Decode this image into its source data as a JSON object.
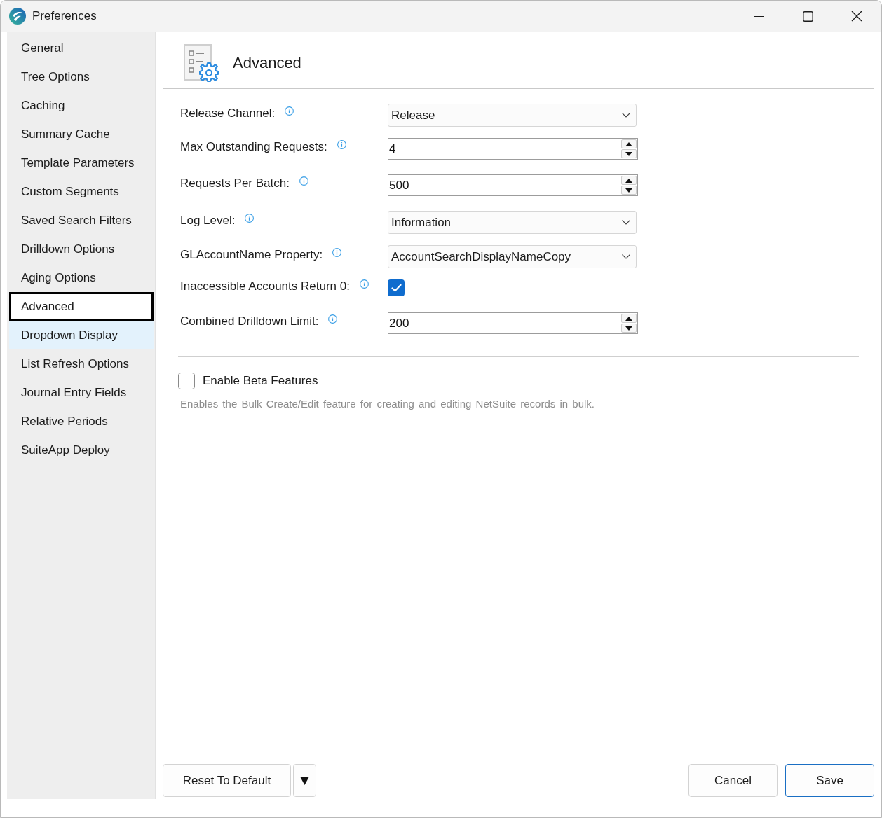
{
  "window": {
    "title": "Preferences"
  },
  "sidebar": {
    "items": [
      {
        "label": "General",
        "selected": false,
        "hovered": false
      },
      {
        "label": "Tree Options",
        "selected": false,
        "hovered": false
      },
      {
        "label": "Caching",
        "selected": false,
        "hovered": false
      },
      {
        "label": "Summary Cache",
        "selected": false,
        "hovered": false
      },
      {
        "label": "Template Parameters",
        "selected": false,
        "hovered": false
      },
      {
        "label": "Custom Segments",
        "selected": false,
        "hovered": false
      },
      {
        "label": "Saved Search Filters",
        "selected": false,
        "hovered": false
      },
      {
        "label": "Drilldown Options",
        "selected": false,
        "hovered": false
      },
      {
        "label": "Aging Options",
        "selected": false,
        "hovered": false
      },
      {
        "label": "Advanced",
        "selected": true,
        "hovered": false
      },
      {
        "label": "Dropdown Display",
        "selected": false,
        "hovered": true
      },
      {
        "label": "List Refresh Options",
        "selected": false,
        "hovered": false
      },
      {
        "label": "Journal Entry Fields",
        "selected": false,
        "hovered": false
      },
      {
        "label": "Relative Periods",
        "selected": false,
        "hovered": false
      },
      {
        "label": "SuiteApp Deploy",
        "selected": false,
        "hovered": false
      }
    ]
  },
  "page": {
    "title": "Advanced"
  },
  "settings": [
    {
      "kind": "dropdown",
      "label": "Release Channel:",
      "value": "Release"
    },
    {
      "kind": "spinner",
      "label": "Max Outstanding Requests:",
      "value": "4"
    },
    {
      "kind": "spinner",
      "label": "Requests Per Batch:",
      "value": "500"
    },
    {
      "kind": "dropdown",
      "label": "Log Level:",
      "value": "Information"
    },
    {
      "kind": "dropdown",
      "label": "GLAccountName Property:",
      "value": "AccountSearchDisplayNameCopy"
    },
    {
      "kind": "checkbox",
      "label": "Inaccessible Accounts Return 0:",
      "checked": true
    },
    {
      "kind": "spinner",
      "label": "Combined Drilldown Limit:",
      "value": "200"
    }
  ],
  "beta": {
    "checked": false,
    "label_parts": [
      {
        "text": "Enable ",
        "underlined": false
      },
      {
        "text": "B",
        "underlined": true
      },
      {
        "text": "eta Features",
        "underlined": false
      }
    ],
    "description": "Enables the Bulk Create/Edit feature for creating and editing NetSuite records in bulk."
  },
  "footer": {
    "reset": {
      "label": "Reset To Default"
    },
    "actions": [
      {
        "label": "Cancel",
        "default": false
      },
      {
        "label": "Save",
        "default": true
      }
    ]
  }
}
